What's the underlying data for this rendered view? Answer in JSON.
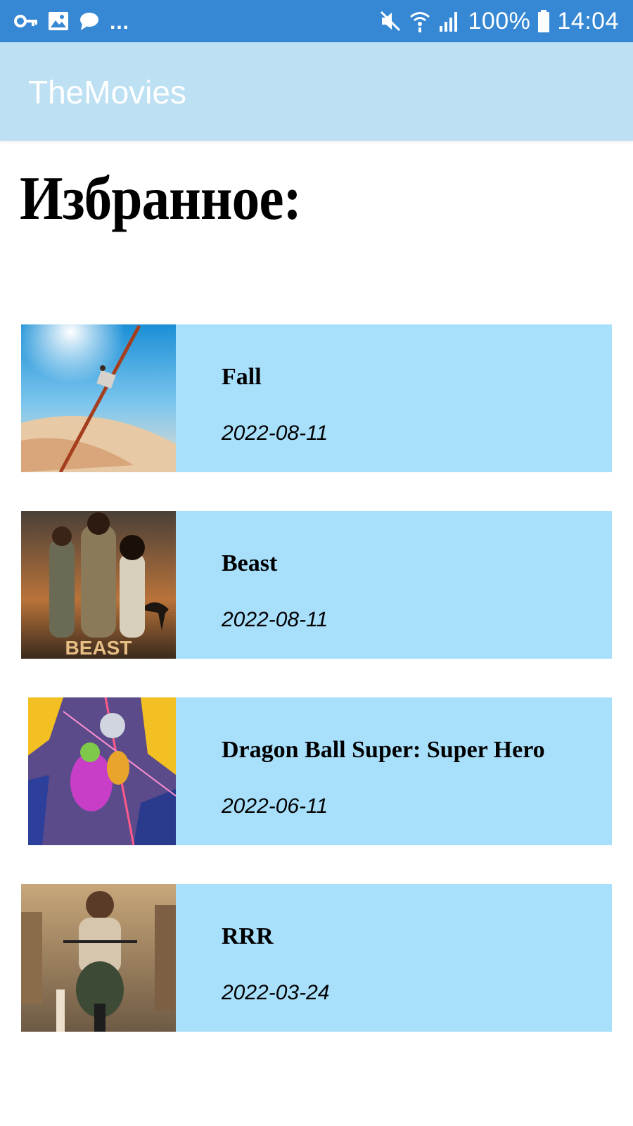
{
  "status_bar": {
    "icons_left": [
      "key-icon",
      "image-icon",
      "message-icon"
    ],
    "more_label": "...",
    "icons_right": [
      "mute-icon",
      "wifi-icon",
      "signal-icon"
    ],
    "battery": "100%",
    "battery_icon": "battery-icon",
    "time": "14:04"
  },
  "app_bar": {
    "title": "TheMovies",
    "background": "#bde0f3"
  },
  "page": {
    "heading": "Избранное:"
  },
  "movies": [
    {
      "title": "Fall",
      "release_date": "2022-08-11"
    },
    {
      "title": "Beast",
      "release_date": "2022-08-11",
      "poster_text": "BEAST"
    },
    {
      "title": "Dragon Ball Super: Super Hero",
      "release_date": "2022-06-11"
    },
    {
      "title": "RRR",
      "release_date": "2022-03-24"
    }
  ],
  "colors": {
    "status_bar": "#3688d4",
    "card_background": "#a8dffb"
  }
}
